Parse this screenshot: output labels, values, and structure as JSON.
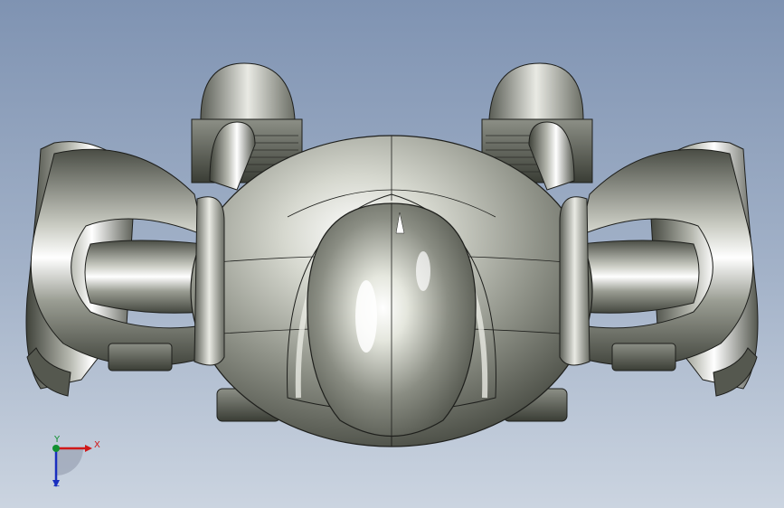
{
  "viewport": {
    "background_top": "#7f93b2",
    "background_bottom": "#cbd4e0",
    "model_shade_colors": [
      "#3b3e36",
      "#6f7268",
      "#a6a99f",
      "#e6e8e0",
      "#ffffff"
    ]
  },
  "triad": {
    "x_label": "X",
    "y_label": "Y",
    "z_label": "Z",
    "x_color": "#d01818",
    "y_color": "#109030",
    "z_color": "#1a2fbf"
  }
}
